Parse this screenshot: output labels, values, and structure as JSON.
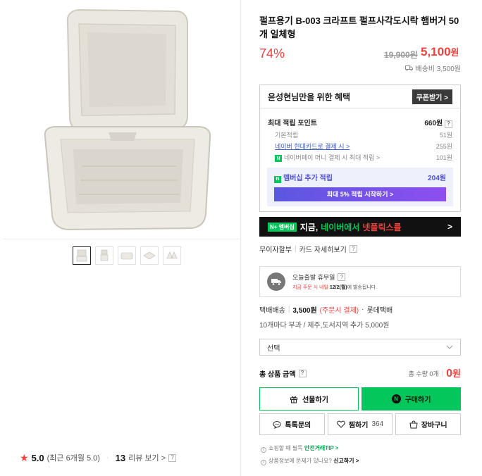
{
  "product": {
    "title": "펄프용기 B-003 크라프트 펄프사각도시락 햄버거 50개 일체형",
    "discount_rate": "74%",
    "original_price": "19,900원",
    "sale_price": "5,100",
    "sale_unit": "원",
    "shipping_fee": "배송비 3,500원"
  },
  "benefit": {
    "header": "윤성현님만을 위한 혜택",
    "coupon_button": "쿠폰받기 >",
    "max_points_label": "최대 적립 포인트",
    "max_points_value": "660원",
    "rows": [
      {
        "label": "기본적립",
        "value": "51원"
      },
      {
        "label": "네이버 현대카드로 결제 시 >",
        "value": "255원"
      },
      {
        "label": "네이버페이 머니 결제 시 최대 적립 >",
        "value": "101원"
      }
    ],
    "membership_label": "멤버십 추가 적립",
    "membership_value": "204원",
    "membership_cta": "최대 5% 적립 시작하기 >"
  },
  "promo": {
    "badge": "N+ 멤버십",
    "text1": "지금,",
    "text2": "네이버에서",
    "text3": "넷플릭스를",
    "arrow": ">"
  },
  "card": {
    "item1": "무이자할부",
    "item2": "카드 자세히보기",
    "q": "?"
  },
  "delivery": {
    "title": "오늘출발 휴무일",
    "q": "?",
    "notice_red": "지금 주문 시 내일",
    "notice_date": "12/2(월)",
    "notice_rest": "에 발송됩니다."
  },
  "shipping": {
    "type": "택배배송",
    "fee": "3,500원",
    "pay": "(주문시 결제)",
    "carrier": "롯데택배",
    "extra": "10개마다 부과 / 제주,도서지역 추가 5,000원"
  },
  "select": {
    "placeholder": "선택"
  },
  "total": {
    "label": "총 상품 금액",
    "q": "?",
    "qty": "총 수량 0개",
    "amount": "0",
    "unit": "원"
  },
  "buttons": {
    "gift": "선물하기",
    "buy": "구매하기",
    "inquiry": "톡톡문의",
    "wish": "찜하기",
    "wish_count": "364",
    "cart": "장바구니"
  },
  "notes": {
    "line1_a": "쇼핑할 때 필독",
    "line1_b": "안전거래TIP >",
    "line2_a": "상품정보에 문제가 있나요?",
    "line2_b": "신고하기 >"
  },
  "rating": {
    "score": "5.0",
    "recent": "(최근 6개월 5.0)",
    "review_count": "13",
    "review_link": "리뷰 보기 >",
    "q": "?"
  },
  "colors": {
    "accent_red": "#f1413c",
    "naver_green": "#03c75a",
    "member_purple": "#5b57e0"
  }
}
